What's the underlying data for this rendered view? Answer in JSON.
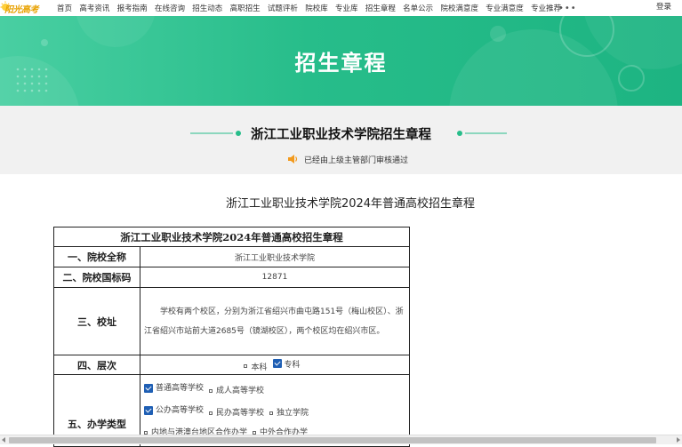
{
  "logo": {
    "text": "阳光高考"
  },
  "nav": {
    "items": [
      "首页",
      "高考资讯",
      "报考指南",
      "在线咨询",
      "招生动态",
      "高职招生",
      "试题评析",
      "院校库",
      "专业库",
      "招生章程",
      "名单公示",
      "院校满意度",
      "专业满意度",
      "专业推荐"
    ],
    "more": "•••",
    "login": "登录"
  },
  "banner": {
    "title": "招生章程"
  },
  "header": {
    "title": "浙江工业职业技术学院招生章程",
    "audit_note": "已经由上级主管部门审核通过"
  },
  "doc": {
    "heading": "浙江工业职业技术学院2024年普通高校招生章程",
    "table_caption": "浙江工业职业技术学院2024年普通高校招生章程",
    "rows": {
      "name_label": "一、院校全称",
      "name_value": "浙江工业职业技术学院",
      "code_label": "二、院校国标码",
      "code_value": "12871",
      "address_label": "三、校址",
      "address_value": "学校有两个校区，分别为浙江省绍兴市曲屯路151号（梅山校区）、浙江省绍兴市站前大道2685号（镜湖校区），两个校区均在绍兴市区。",
      "level_label": "四、层次",
      "level_options": [
        {
          "label": "本科",
          "checked": false
        },
        {
          "label": "专科",
          "checked": true
        }
      ],
      "type_label": "五、办学类型",
      "type_line1": [
        {
          "label": "普通高等学校",
          "checked": true
        },
        {
          "label": "成人高等学校",
          "checked": false
        }
      ],
      "type_line2": [
        {
          "label": "公办高等学校",
          "checked": true
        },
        {
          "label": "民办高等学校",
          "checked": false
        },
        {
          "label": "独立学院",
          "checked": false
        },
        {
          "label": "内地与港澳台地区合作办学",
          "checked": false
        },
        {
          "label": "中外合作办学",
          "checked": false
        }
      ]
    }
  },
  "colors": {
    "banner_green": "#27bd8a",
    "band_gray": "#f1f1f1",
    "check_blue": "#1f5fb4",
    "audio_orange": "#f29a1d"
  }
}
